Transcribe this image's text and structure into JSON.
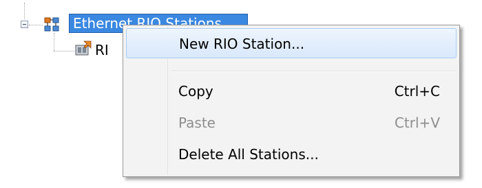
{
  "tree": {
    "root_label": "Ethernet RIO Stations",
    "child_label": "RI",
    "icons": {
      "root": "network-tree-icon",
      "child": "rio-station-icon"
    }
  },
  "context_menu": {
    "items": [
      {
        "label": "New RIO Station...",
        "shortcut": "",
        "state": "highlighted"
      },
      {
        "label": "Copy",
        "shortcut": "Ctrl+C",
        "state": "enabled"
      },
      {
        "label": "Paste",
        "shortcut": "Ctrl+V",
        "state": "disabled"
      },
      {
        "label": "Delete All Stations...",
        "shortcut": "",
        "state": "enabled"
      }
    ]
  },
  "colors": {
    "selection": "#3b88e0",
    "menu_background": "#f3f3f3",
    "highlight": "#d9e8fb",
    "disabled_text": "#8d8d8d"
  }
}
